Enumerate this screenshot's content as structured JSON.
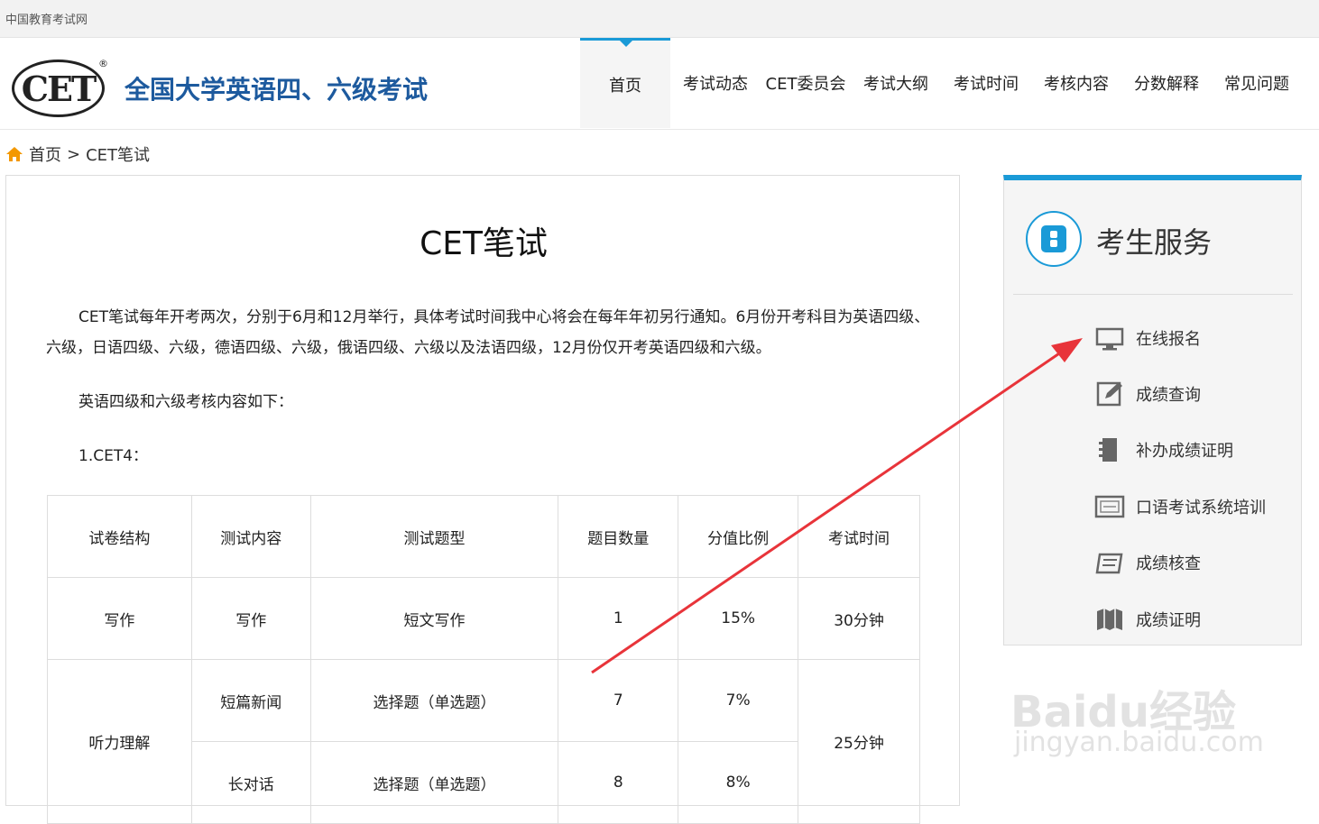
{
  "topbar": {
    "site": "中国教育考试网"
  },
  "header": {
    "logo_text": "CET",
    "logo_reg": "®",
    "title": "全国大学英语四、六级考试"
  },
  "nav": [
    "首页",
    "考试动态",
    "CET委员会",
    "考试大纲",
    "考试时间",
    "考核内容",
    "分数解释",
    "常见问题"
  ],
  "breadcrumb": {
    "home": "首页",
    "sep": ">",
    "current": "CET笔试"
  },
  "article": {
    "title": "CET笔试",
    "p1": "CET笔试每年开考两次，分别于6月和12月举行，具体考试时间我中心将会在每年年初另行通知。6月份开考科目为英语四级、六级，日语四级、六级，德语四级、六级，俄语四级、六级以及法语四级，12月份仅开考英语四级和六级。",
    "p2": "英语四级和六级考核内容如下：",
    "p3": "1.CET4："
  },
  "table": {
    "headers": [
      "试卷结构",
      "测试内容",
      "测试题型",
      "题目数量",
      "分值比例",
      "考试时间"
    ],
    "rows": [
      [
        "写作",
        "写作",
        "短文写作",
        "1",
        "15%",
        "30分钟"
      ],
      [
        "听力理解",
        "短篇新闻",
        "选择题（单选题）",
        "7",
        "7%",
        "25分钟"
      ],
      [
        "",
        "长对话",
        "选择题（单选题）",
        "8",
        "8%",
        ""
      ]
    ]
  },
  "sidebar": {
    "title": "考生服务",
    "items": [
      {
        "label": "在线报名",
        "icon": "monitor-icon"
      },
      {
        "label": "成绩查询",
        "icon": "edit-icon"
      },
      {
        "label": "补办成绩证明",
        "icon": "notebook-icon"
      },
      {
        "label": "口语考试系统培训",
        "icon": "screen-icon"
      },
      {
        "label": "成绩核查",
        "icon": "scroll-icon"
      },
      {
        "label": "成绩证明",
        "icon": "map-icon"
      }
    ]
  },
  "watermark": {
    "line1": "Baidu经验",
    "line2": "jingyan.baidu.com"
  },
  "colors": {
    "accent": "#1a9ad7",
    "title_blue": "#1d5a9e",
    "arrow": "#e8343a"
  }
}
